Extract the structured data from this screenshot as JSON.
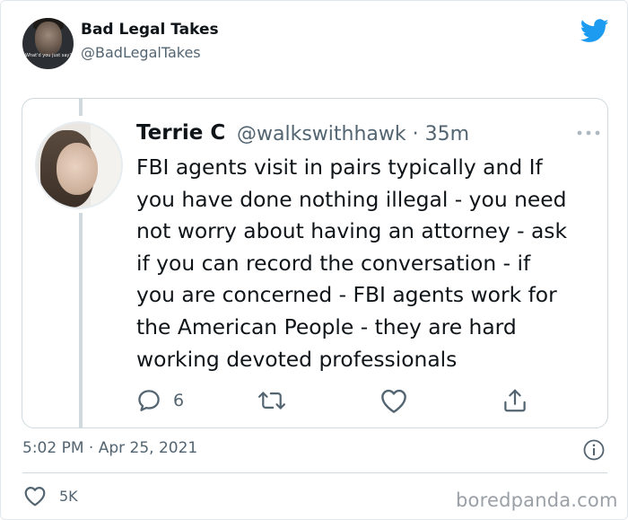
{
  "header": {
    "avatar_caption": "What'd you just say?",
    "author_name": "Bad Legal Takes",
    "author_handle": "@BadLegalTakes",
    "logo_icon": "twitter-bird-icon",
    "brand_color": "#1d9bf0"
  },
  "quoted_tweet": {
    "author_name": "Terrie C",
    "author_handle": "@walkswithhawk",
    "time_ago": "35m",
    "meta_separator": "·",
    "text_lines": [
      "FBI agents visit in pairs typically and If",
      "you have done nothing illegal - you need",
      "not worry about having an attorney - ask",
      "if you can record the conversation - if",
      "you are concerned - FBI agents work for",
      "the American People - they are hard",
      "working devoted professionals"
    ],
    "reply_count": "6",
    "icons": [
      "reply-icon",
      "retweet-icon",
      "like-icon",
      "share-icon"
    ]
  },
  "footer": {
    "timestamp": "5:02 PM · Apr 25, 2021",
    "like_count": "5K",
    "watermark": "boredpanda.com"
  }
}
